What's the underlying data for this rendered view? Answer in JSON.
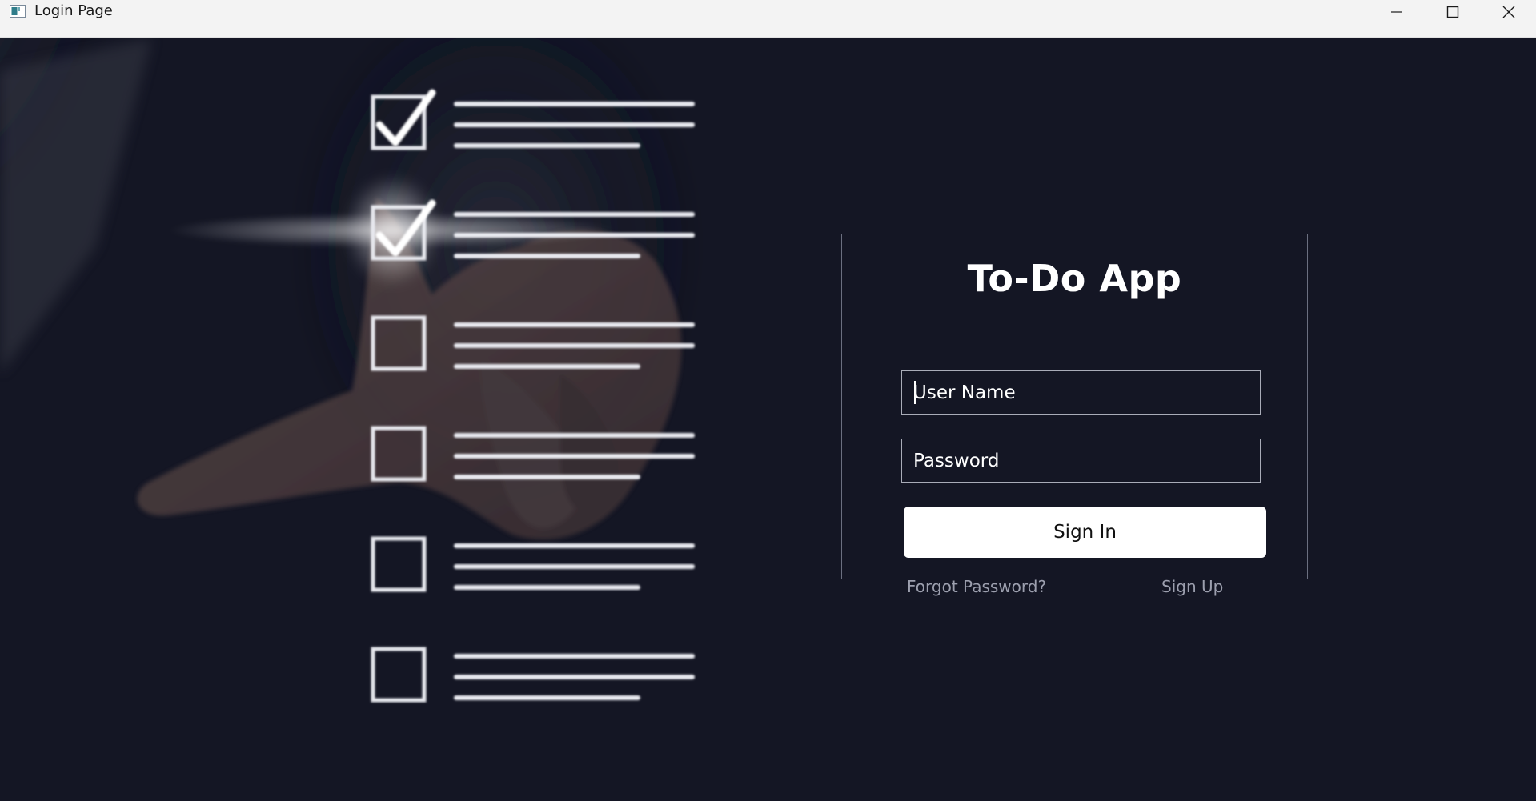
{
  "window": {
    "title": "Login Page",
    "icon": "app-window-icon"
  },
  "titlebar_controls": {
    "minimize": "minimize-icon",
    "maximize": "maximize-icon",
    "close": "close-icon"
  },
  "hero": {
    "checklist_items": [
      {
        "checked": true
      },
      {
        "checked": true,
        "highlighted": true
      },
      {
        "checked": false
      },
      {
        "checked": false
      },
      {
        "checked": false
      },
      {
        "checked": false
      }
    ]
  },
  "login": {
    "title": "To-Do App",
    "username_placeholder": "User Name",
    "password_placeholder": "Password",
    "signin_label": "Sign In",
    "forgot_label": "Forgot Password?",
    "signup_label": "Sign Up"
  },
  "colors": {
    "background": "#141624",
    "card_border": "#6b6f80",
    "button_bg": "#ffffff",
    "link": "#9c9fae"
  }
}
